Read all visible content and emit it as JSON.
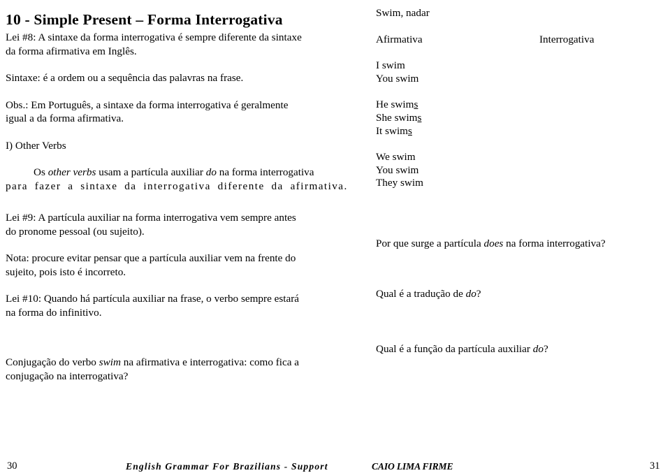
{
  "document": {
    "title": "10 - Simple Present – Forma Interrogativa",
    "left_column": {
      "law8": {
        "line1": "Lei #8: A sintaxe da forma interrogativa é sempre diferente da sintaxe",
        "line2": "da forma afirmativa em Inglês."
      },
      "syntax_def": "Sintaxe: é a ordem ou a sequência das palavras na frase.",
      "obs": {
        "line1": "Obs.: Em Português, a sintaxe da forma interrogativa é geralmente",
        "line2": "igual a da forma afirmativa."
      },
      "section_heading": "I)  Other Verbs",
      "other_verbs": {
        "line1_pre": "Os ",
        "line1_italic": "other verbs",
        "line1_mid": " usam a partícula auxiliar ",
        "line1_italic2": "do",
        "line1_post": " na forma interrogativa",
        "line2": "para fazer a sintaxe da interrogativa diferente da afirmativa."
      },
      "law9": {
        "line1": "Lei #9: A partícula auxiliar na forma interrogativa vem sempre antes",
        "line2": "do pronome pessoal (ou sujeito)."
      },
      "note": {
        "line1": "Nota: procure evitar pensar que a partícula auxiliar vem na frente do",
        "line2": "sujeito, pois isto é incorreto."
      },
      "law10": {
        "line1": "Lei #10: Quando há partícula auxiliar na frase, o verbo sempre estará",
        "line2": "na forma do infinitivo."
      },
      "conjugation_prompt": {
        "line1_pre": "Conjugação do verbo ",
        "line1_italic": "swim",
        "line1_post": "  na afirmativa e interrogativa: como fica a",
        "line2": "conjugação na interrogativa?"
      }
    },
    "right_column": {
      "verb_gloss": "Swim, nadar",
      "column_headers": {
        "affirmative": "Afirmativa",
        "interrogative": "Interrogativa"
      },
      "conjugation_group1": [
        {
          "subject": "I",
          "verb": "swim",
          "suffix": ""
        },
        {
          "subject": "You",
          "verb": "swim",
          "suffix": ""
        }
      ],
      "conjugation_group2": [
        {
          "subject": "He",
          "verb": "swim",
          "suffix": "s"
        },
        {
          "subject": "She",
          "verb": "swim",
          "suffix": "s"
        },
        {
          "subject": "It",
          "verb": "swim",
          "suffix": "s"
        }
      ],
      "conjugation_group3": [
        {
          "subject": "We",
          "verb": "swim",
          "suffix": ""
        },
        {
          "subject": "You",
          "verb": "swim",
          "suffix": ""
        },
        {
          "subject": "They",
          "verb": "swim",
          "suffix": ""
        }
      ],
      "question1": {
        "pre": "Por que surge a partícula  ",
        "italic": "does",
        "post": "  na forma interrogativa?"
      },
      "question2": {
        "pre": "Qual é a tradução de ",
        "italic": "do",
        "post": "?"
      },
      "question3": {
        "pre": "Qual é a função da partícula auxiliar  ",
        "italic": "do",
        "post": "?"
      }
    },
    "footer": {
      "page_left": "30",
      "book_title": "English Grammar For Brazilians - Support",
      "author": "CAIO LIMA FIRME",
      "page_right": "31"
    },
    "colors": {
      "background": "#ffffff",
      "text": "#000000"
    }
  }
}
